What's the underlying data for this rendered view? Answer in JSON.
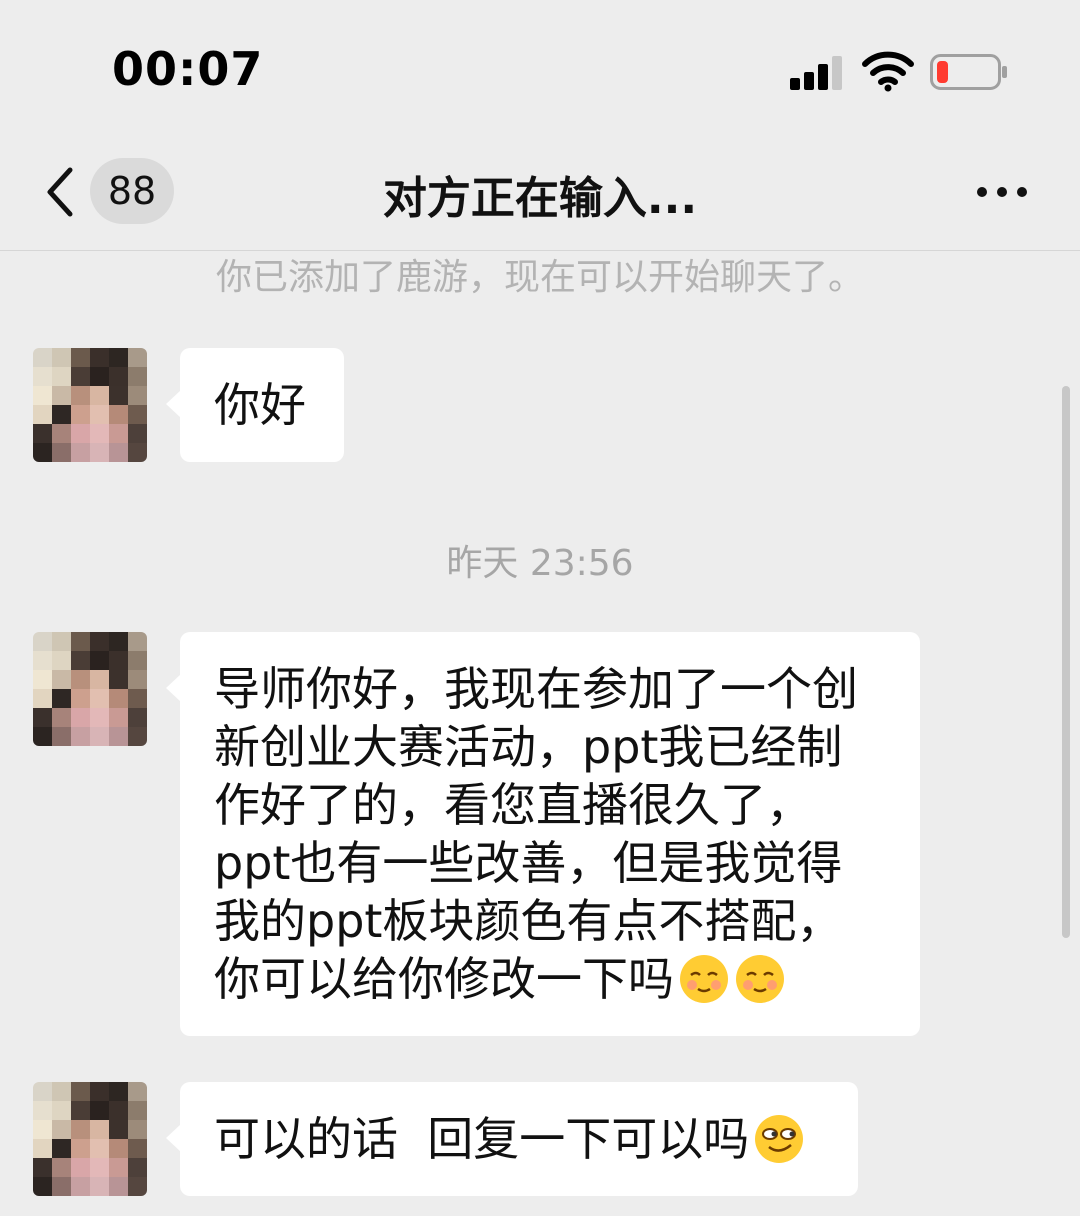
{
  "status_bar": {
    "time": "00:07",
    "icons": [
      "signal-icon",
      "wifi-icon",
      "battery-icon"
    ],
    "battery_color": "#ff3b30"
  },
  "nav": {
    "unread_count": "88",
    "title": "对方正在输入...",
    "back_icon": "chevron-left-icon",
    "more_icon": "more-icon"
  },
  "chat": {
    "system_notice": "你已添加了鹿游，现在可以开始聊天了。",
    "timestamp": "昨天 23:56",
    "messages": [
      {
        "sender": "other",
        "lines": [
          "你好"
        ]
      },
      {
        "sender": "other",
        "lines": [
          "导师你好，我现在参加了一个创",
          "新创业大赛活动，ppt我已经制",
          "作好了的，看您直播很久了，",
          "ppt也有一些改善，但是我觉得",
          "我的ppt板块颜色有点不搭配，",
          "你可以给你修改一下吗"
        ],
        "emojis": [
          "blush-emoji",
          "blush-emoji"
        ]
      },
      {
        "sender": "other",
        "lines": [
          "可以的话  回复一下可以吗"
        ],
        "emojis": [
          "smirk-emoji"
        ]
      }
    ]
  },
  "colors": {
    "background": "#ededed",
    "bubble": "#ffffff",
    "system_text": "#b3b3b3"
  }
}
